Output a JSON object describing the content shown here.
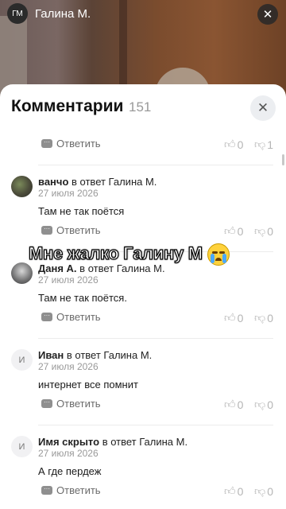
{
  "top_bar": {
    "avatar_initials": "ГМ",
    "title": "Галина М.",
    "close_icon": "close-icon"
  },
  "sheet": {
    "title": "Комментарии",
    "count": "151",
    "close_icon": "close-icon"
  },
  "first_actions": {
    "reply_label": "Ответить",
    "likes": "0",
    "dislikes": "1"
  },
  "comments": [
    {
      "author": "ванчо",
      "reply_to": "в ответ Галина М.",
      "date": "27 июля 2026",
      "text": "Там не так поётся",
      "reply_label": "Ответить",
      "likes": "0",
      "dislikes": "0",
      "avatar": "photo"
    },
    {
      "author": "Даня А.",
      "reply_to": "в ответ Галина М.",
      "date": "27 июля 2026",
      "text": "Там не так поётся.",
      "reply_label": "Ответить",
      "likes": "0",
      "dislikes": "0",
      "avatar": "photo"
    },
    {
      "author": "Иван",
      "reply_to": "в ответ Галина М.",
      "date": "27 июля 2026",
      "text": "интернет все помнит",
      "reply_label": "Ответить",
      "likes": "0",
      "dislikes": "0",
      "avatar": "И"
    },
    {
      "author": "Имя скрыто",
      "reply_to": "в ответ Галина М.",
      "date": "27 июля 2026",
      "text": "А где пердеж",
      "reply_label": "Ответить",
      "likes": "0",
      "dislikes": "0",
      "avatar": "И"
    }
  ],
  "overlay_caption": "Мне жалко Галину М",
  "overlay_emoji": "loudly-crying-face-icon"
}
